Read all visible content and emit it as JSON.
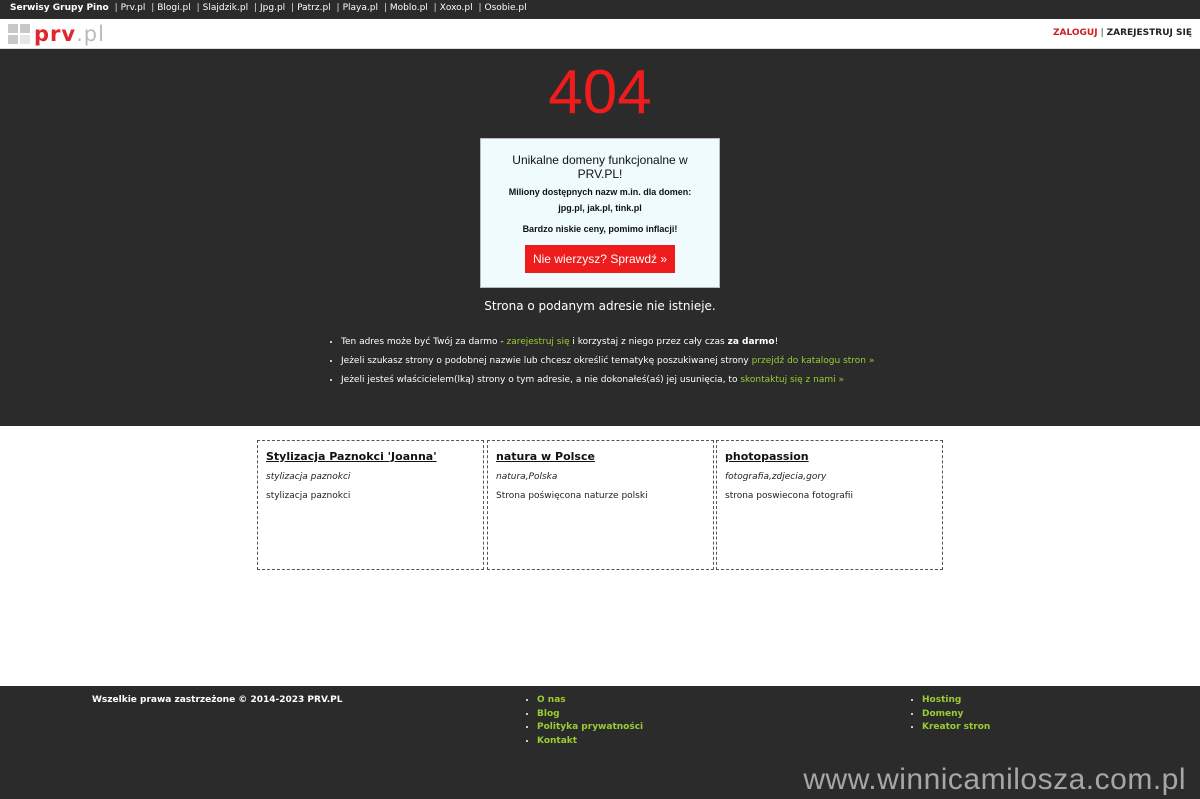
{
  "network_bar": {
    "brand": "Serwisy Grupy Pino",
    "links": [
      "Prv.pl",
      "Blogi.pl",
      "Slajdzik.pl",
      "Jpg.pl",
      "Patrz.pl",
      "Playa.pl",
      "Moblo.pl",
      "Xoxo.pl",
      "Osobie.pl"
    ]
  },
  "header": {
    "logo_text": "prv",
    "logo_suffix": ".pl",
    "login": "ZALOGUJ",
    "separator": "|",
    "register": "ZAREJESTRUJ SIĘ"
  },
  "error": {
    "code": "404",
    "message": "Strona o podanym adresie nie istnieje."
  },
  "promo": {
    "line1": "Unikalne domeny funkcjonalne w PRV.PL!",
    "line2": "Miliony dostępnych nazw m.in. dla domen:",
    "line3": "jpg.pl, jak.pl, tink.pl",
    "line4": "Bardzo niskie ceny, pomimo inflacji!",
    "button": "Nie wierzysz? Sprawdź »"
  },
  "tips": [
    {
      "before": "Ten adres może być Twój za darmo - ",
      "link": "zarejestruj się",
      "after": " i korzystaj z niego przez cały czas ",
      "bold": "za darmo",
      "end": "!"
    },
    {
      "before": "Jeżeli szukasz strony o podobnej nazwie lub chcesz określić tematykę poszukiwanej strony ",
      "link": "przejdź do katalogu stron »",
      "after": "",
      "bold": "",
      "end": ""
    },
    {
      "before": "Jeżeli jesteś właścicielem(lką) strony o tym adresie, a nie dokonałeś(aś) jej usunięcia, to ",
      "link": "skontaktuj się z nami »",
      "after": "",
      "bold": "",
      "end": ""
    }
  ],
  "cards": [
    {
      "title": "Stylizacja Paznokci 'Joanna'",
      "tags": "stylizacja paznokci",
      "desc": "stylizacja paznokci"
    },
    {
      "title": "natura w Polsce",
      "tags": "natura,Polska",
      "desc": "Strona poświęcona naturze polski"
    },
    {
      "title": "photopassion",
      "tags": "fotografia,zdjecia,gory",
      "desc": "strona poswiecona fotografii"
    }
  ],
  "footer": {
    "copyright": "Wszelkie prawa zastrzeżone © 2014-2023 PRV.PL",
    "links_col1": [
      "O nas",
      "Blog",
      "Polityka prywatności",
      "Kontakt"
    ],
    "links_col2": [
      "Hosting",
      "Domeny",
      "Kreator stron"
    ]
  },
  "watermark": "www.winnicamilosza.com.pl",
  "colors": {
    "dark_bg": "#2b2b2b",
    "accent_red": "#ee1c1c",
    "link_green": "#9acd32",
    "promo_bg": "#f0fbfd"
  }
}
